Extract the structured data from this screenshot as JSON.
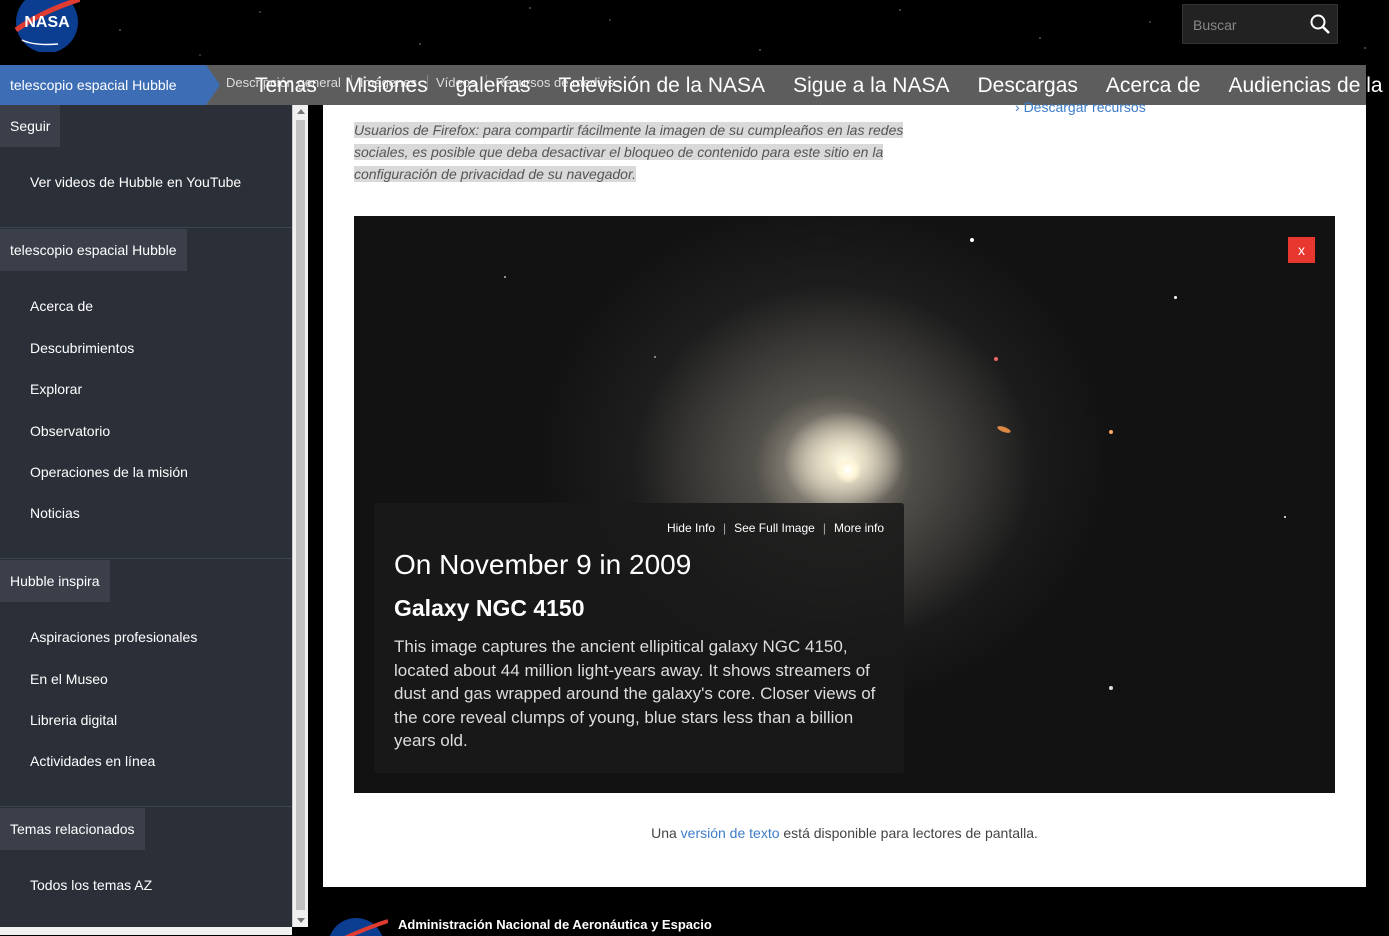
{
  "header": {
    "logo_text": "NASA",
    "search_placeholder": "Buscar"
  },
  "nav": {
    "hubble_tab": "telescopio espacial Hubble",
    "sub_items": [
      "Descripción general",
      "Imágenes",
      "Vídeos",
      "Recursos de medios"
    ],
    "main_items": [
      "Temas",
      "Misiones",
      "galerías",
      "Televisión de la NASA",
      "Sigue a la NASA",
      "Descargas",
      "Acerca de",
      "Audiencias de la NASA"
    ]
  },
  "sidebar": {
    "sections": [
      {
        "head": "Seguir",
        "items": [
          "Ver videos de Hubble en YouTube"
        ]
      },
      {
        "head": "telescopio espacial Hubble",
        "items": [
          "Acerca de",
          "Descubrimientos",
          "Explorar",
          "Observatorio",
          "Operaciones de la misión",
          "Noticias"
        ]
      },
      {
        "head": "Hubble inspira",
        "items": [
          "Aspiraciones profesionales",
          "En el Museo",
          "Libreria digital",
          "Actividades en línea"
        ]
      },
      {
        "head": "Temas relacionados",
        "items": [
          "Todos los temas AZ"
        ]
      }
    ]
  },
  "content": {
    "firefox_note": "Usuarios de Firefox: para compartir fácilmente la imagen de su cumpleaños en las redes sociales, es posible que deba desactivar el bloqueo de contenido para este sitio en la configuración de privacidad de su navegador.",
    "download_link": "Descargar recursos",
    "close_label": "x",
    "info_links": {
      "hide": "Hide Info",
      "full": "See Full Image",
      "more": "More info",
      "sep": "|"
    },
    "date": "On November 9 in 2009",
    "title": "Galaxy NGC 4150",
    "description": "This image captures the ancient ellipitical galaxy NGC 4150, located about 44 million light-years away. It shows streamers of dust and gas wrapped around the galaxy's core. Closer views of the core reveal clumps of young, blue stars less than a billion years old.",
    "screenreader_pre": "Una",
    "screenreader_link": "versión de texto",
    "screenreader_post": "está disponible para lectores de pantalla."
  },
  "footer": {
    "agency": "Administración Nacional de Aeronáutica y Espacio"
  },
  "colors": {
    "hubble_tab": "#3d6eb5",
    "navbar": "#5d5d5d",
    "sidebar": "#2b2f38",
    "close_button": "#e8372e",
    "link": "#3d7cc9"
  }
}
